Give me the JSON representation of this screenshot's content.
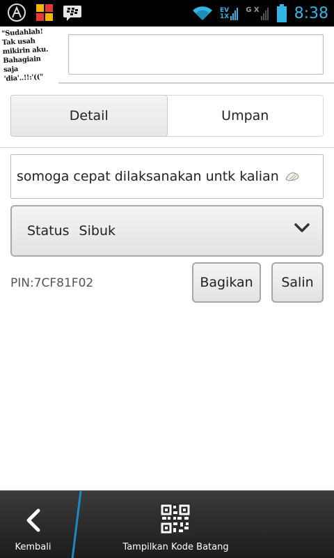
{
  "status_bar": {
    "time": "8:38",
    "network_top": "EV",
    "network_bottom": "1X",
    "data_label": "G X",
    "accent": "#33b5e5"
  },
  "profile": {
    "avatar_text": "\"Sudahlah! Tak usah mikirin aku. Bahagiain saja 'dia'..!!:'((\"",
    "name_value": ""
  },
  "tabs": [
    {
      "label": "Detail",
      "active": true
    },
    {
      "label": "Umpan",
      "active": false
    }
  ],
  "personal_message": {
    "value": "somoga cepat dilaksanakan untk kalian"
  },
  "status": {
    "label": "Status",
    "value": "Sibuk"
  },
  "pin": {
    "text": "PIN:7CF81F02"
  },
  "actions": {
    "share_label": "Bagikan",
    "copy_label": "Salin"
  },
  "bottom_bar": {
    "back_label": "Kembali",
    "barcode_label": "Tampilkan Kode Batang"
  }
}
